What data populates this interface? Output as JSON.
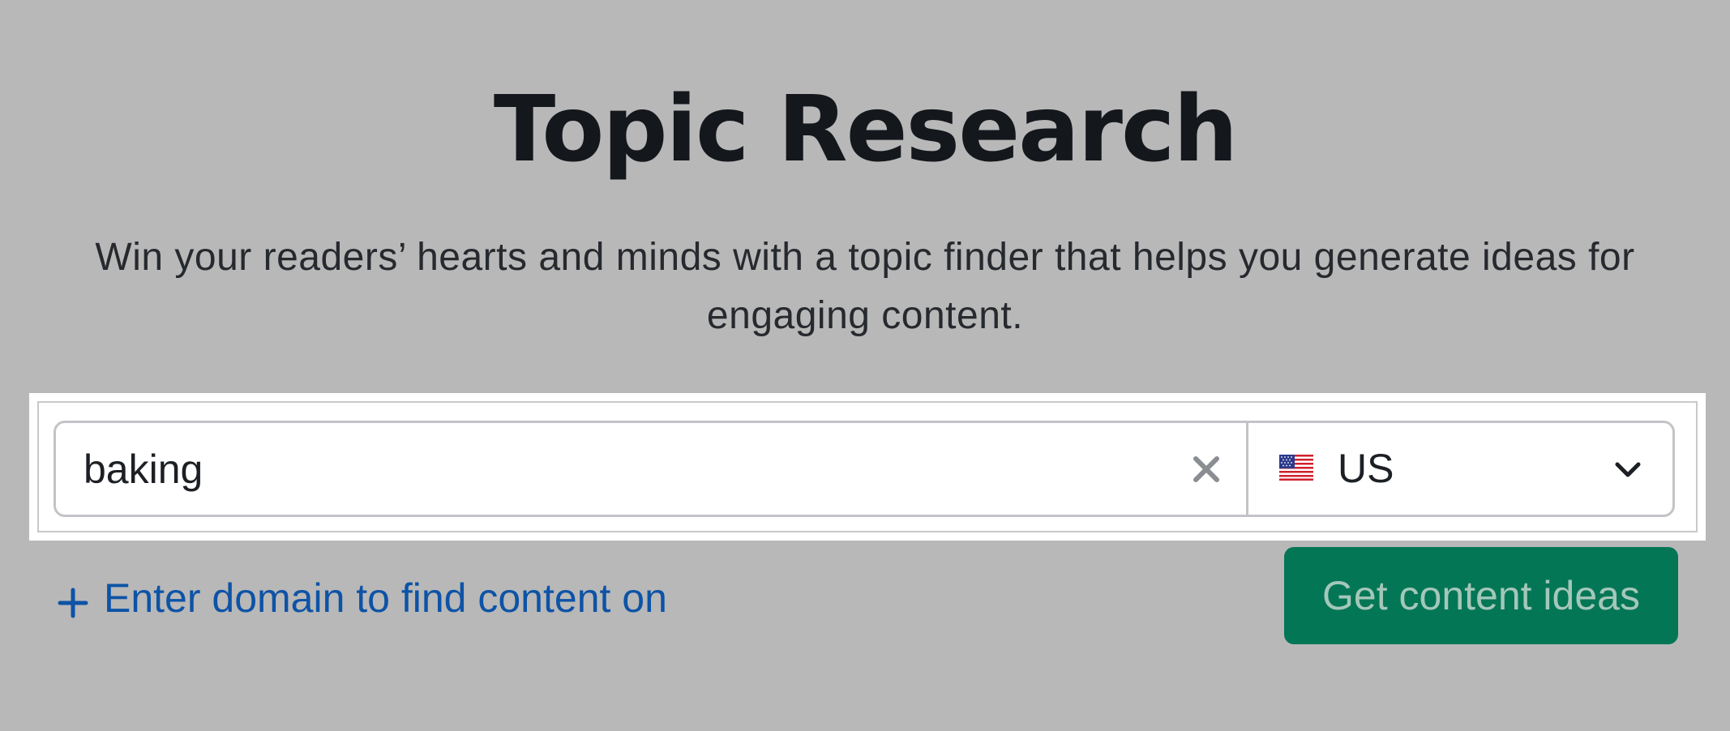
{
  "header": {
    "title": "Topic Research",
    "subtitle": "Win your readers’ hearts and minds with a topic finder that helps you generate ideas for engaging content."
  },
  "search": {
    "value": "baking",
    "clear_icon": "close-icon"
  },
  "country": {
    "selected": "US",
    "flag_icon": "us-flag-icon",
    "dropdown_icon": "chevron-down-icon"
  },
  "domain_link": {
    "icon": "plus-icon",
    "label": "Enter domain to find content on"
  },
  "cta": {
    "label": "Get content ideas"
  },
  "colors": {
    "background": "#b8b8b8",
    "link": "#0d53a6",
    "cta_background": "#037656"
  }
}
